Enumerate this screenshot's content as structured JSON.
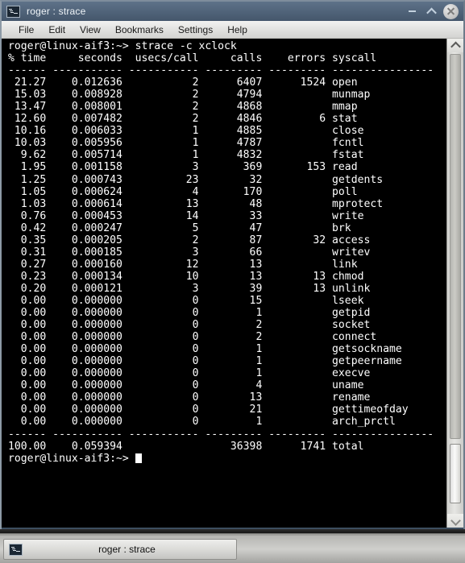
{
  "window": {
    "title": "roger : strace",
    "icon": "terminal-icon",
    "buttons": {
      "minimize": "minimize-icon",
      "maximize": "maximize-icon",
      "close": "close-icon"
    }
  },
  "menubar": {
    "items": [
      "File",
      "Edit",
      "View",
      "Bookmarks",
      "Settings",
      "Help"
    ]
  },
  "terminal": {
    "prompt": "roger@linux-aif3:~>",
    "command": "strace -c xclock",
    "command_line": "roger@linux-aif3:~> strace -c xclock",
    "header": "% time     seconds  usecs/call     calls    errors syscall",
    "separator": "------ ----------- ----------- --------- --------- ----------------",
    "columns": [
      "% time",
      "seconds",
      "usecs/call",
      "calls",
      "errors",
      "syscall"
    ],
    "rows": [
      {
        "time": "21.27",
        "seconds": "0.012636",
        "usecs": "2",
        "calls": "6407",
        "errors": "1524",
        "syscall": "open"
      },
      {
        "time": "15.03",
        "seconds": "0.008928",
        "usecs": "2",
        "calls": "4794",
        "errors": "",
        "syscall": "munmap"
      },
      {
        "time": "13.47",
        "seconds": "0.008001",
        "usecs": "2",
        "calls": "4868",
        "errors": "",
        "syscall": "mmap"
      },
      {
        "time": "12.60",
        "seconds": "0.007482",
        "usecs": "2",
        "calls": "4846",
        "errors": "6",
        "syscall": "stat"
      },
      {
        "time": "10.16",
        "seconds": "0.006033",
        "usecs": "1",
        "calls": "4885",
        "errors": "",
        "syscall": "close"
      },
      {
        "time": "10.03",
        "seconds": "0.005956",
        "usecs": "1",
        "calls": "4787",
        "errors": "",
        "syscall": "fcntl"
      },
      {
        "time": "9.62",
        "seconds": "0.005714",
        "usecs": "1",
        "calls": "4832",
        "errors": "",
        "syscall": "fstat"
      },
      {
        "time": "1.95",
        "seconds": "0.001158",
        "usecs": "3",
        "calls": "369",
        "errors": "153",
        "syscall": "read"
      },
      {
        "time": "1.25",
        "seconds": "0.000743",
        "usecs": "23",
        "calls": "32",
        "errors": "",
        "syscall": "getdents"
      },
      {
        "time": "1.05",
        "seconds": "0.000624",
        "usecs": "4",
        "calls": "170",
        "errors": "",
        "syscall": "poll"
      },
      {
        "time": "1.03",
        "seconds": "0.000614",
        "usecs": "13",
        "calls": "48",
        "errors": "",
        "syscall": "mprotect"
      },
      {
        "time": "0.76",
        "seconds": "0.000453",
        "usecs": "14",
        "calls": "33",
        "errors": "",
        "syscall": "write"
      },
      {
        "time": "0.42",
        "seconds": "0.000247",
        "usecs": "5",
        "calls": "47",
        "errors": "",
        "syscall": "brk"
      },
      {
        "time": "0.35",
        "seconds": "0.000205",
        "usecs": "2",
        "calls": "87",
        "errors": "32",
        "syscall": "access"
      },
      {
        "time": "0.31",
        "seconds": "0.000185",
        "usecs": "3",
        "calls": "66",
        "errors": "",
        "syscall": "writev"
      },
      {
        "time": "0.27",
        "seconds": "0.000160",
        "usecs": "12",
        "calls": "13",
        "errors": "",
        "syscall": "link"
      },
      {
        "time": "0.23",
        "seconds": "0.000134",
        "usecs": "10",
        "calls": "13",
        "errors": "13",
        "syscall": "chmod"
      },
      {
        "time": "0.20",
        "seconds": "0.000121",
        "usecs": "3",
        "calls": "39",
        "errors": "13",
        "syscall": "unlink"
      },
      {
        "time": "0.00",
        "seconds": "0.000000",
        "usecs": "0",
        "calls": "15",
        "errors": "",
        "syscall": "lseek"
      },
      {
        "time": "0.00",
        "seconds": "0.000000",
        "usecs": "0",
        "calls": "1",
        "errors": "",
        "syscall": "getpid"
      },
      {
        "time": "0.00",
        "seconds": "0.000000",
        "usecs": "0",
        "calls": "2",
        "errors": "",
        "syscall": "socket"
      },
      {
        "time": "0.00",
        "seconds": "0.000000",
        "usecs": "0",
        "calls": "2",
        "errors": "",
        "syscall": "connect"
      },
      {
        "time": "0.00",
        "seconds": "0.000000",
        "usecs": "0",
        "calls": "1",
        "errors": "",
        "syscall": "getsockname"
      },
      {
        "time": "0.00",
        "seconds": "0.000000",
        "usecs": "0",
        "calls": "1",
        "errors": "",
        "syscall": "getpeername"
      },
      {
        "time": "0.00",
        "seconds": "0.000000",
        "usecs": "0",
        "calls": "1",
        "errors": "",
        "syscall": "execve"
      },
      {
        "time": "0.00",
        "seconds": "0.000000",
        "usecs": "0",
        "calls": "4",
        "errors": "",
        "syscall": "uname"
      },
      {
        "time": "0.00",
        "seconds": "0.000000",
        "usecs": "0",
        "calls": "13",
        "errors": "",
        "syscall": "rename"
      },
      {
        "time": "0.00",
        "seconds": "0.000000",
        "usecs": "0",
        "calls": "21",
        "errors": "",
        "syscall": "gettimeofday"
      },
      {
        "time": "0.00",
        "seconds": "0.000000",
        "usecs": "0",
        "calls": "1",
        "errors": "",
        "syscall": "arch_prctl"
      }
    ],
    "total": {
      "time": "100.00",
      "seconds": "0.059394",
      "usecs": "",
      "calls": "36398",
      "errors": "1741",
      "syscall": "total"
    },
    "final_prompt": "roger@linux-aif3:~>",
    "colors": {
      "background": "#000000",
      "foreground": "#ffffff"
    }
  },
  "scrollbar": {
    "up_arrow": "chevron-up-icon",
    "down_arrow": "chevron-down-icon"
  },
  "taskbar": {
    "task_label": "roger : strace",
    "task_icon": "terminal-icon"
  }
}
